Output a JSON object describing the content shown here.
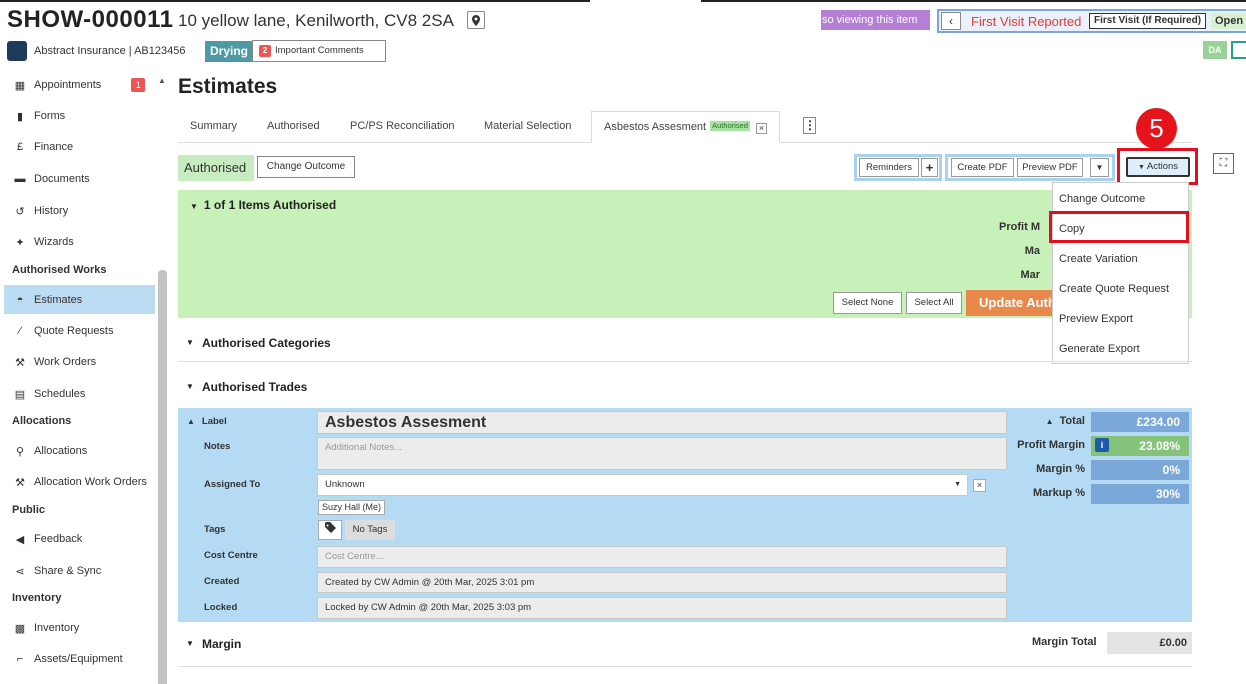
{
  "header": {
    "job_id": "SHOW-000011",
    "address": "10 yellow lane, Kenilworth, CV8 2SA",
    "viewing_notice": "so viewing this item",
    "status": "First Visit Reported",
    "first_visit_badge": "First Visit (If Required)",
    "open_badge": "Open",
    "insurer": "Abstract Insurance | AB123456",
    "drying_badge": "Drying",
    "important_count": "2",
    "important_label": "Important Comments",
    "user_initials": "DA"
  },
  "sidebar": {
    "items": [
      {
        "label": "Appointments",
        "icon": "calendar-icon",
        "badge": "1"
      },
      {
        "label": "Forms",
        "icon": "file-icon"
      },
      {
        "label": "Finance",
        "icon": "pound-icon"
      },
      {
        "label": "Documents",
        "icon": "folder-icon"
      },
      {
        "label": "History",
        "icon": "history-icon"
      },
      {
        "label": "Wizards",
        "icon": "magic-wand-icon"
      }
    ],
    "section_authorised": "Authorised Works",
    "authorised_items": [
      {
        "label": "Estimates",
        "icon": "hard-hat-icon",
        "active": true
      },
      {
        "label": "Quote Requests",
        "icon": "brush-icon"
      },
      {
        "label": "Work Orders",
        "icon": "hammer-icon"
      },
      {
        "label": "Schedules",
        "icon": "schedule-icon"
      }
    ],
    "section_allocations": "Allocations",
    "allocations_items": [
      {
        "label": "Allocations",
        "icon": "wrench-icon"
      },
      {
        "label": "Allocation Work Orders",
        "icon": "hammer-icon"
      }
    ],
    "section_public": "Public",
    "public_items": [
      {
        "label": "Feedback",
        "icon": "megaphone-icon"
      },
      {
        "label": "Share & Sync",
        "icon": "share-icon"
      }
    ],
    "section_inventory": "Inventory",
    "inventory_items": [
      {
        "label": "Inventory",
        "icon": "boxes-icon"
      },
      {
        "label": "Assets/Equipment",
        "icon": "dolly-icon"
      }
    ]
  },
  "main": {
    "title": "Estimates",
    "tabs": [
      "Summary",
      "Authorised",
      "PC/PS Reconciliation",
      "Material Selection"
    ],
    "active_tab": "Asbestos Assesment",
    "active_tab_badge": "Authorised",
    "outcome": "Authorised",
    "change_outcome": "Change Outcome",
    "reminders": "Reminders",
    "plus": "+",
    "create_pdf": "Create PDF",
    "preview_pdf": "Preview PDF",
    "actions": "Actions",
    "step_number": "5"
  },
  "actions_menu": {
    "items": [
      "Change Outcome",
      "Copy",
      "Create Variation",
      "Create Quote Request",
      "Preview Export",
      "Generate Export"
    ],
    "highlighted": "Copy"
  },
  "authorised_panel": {
    "title": "1 of 1 Items Authorised",
    "labels": [
      "Profit M",
      "Ma",
      "Mar"
    ],
    "select_none": "Select None",
    "select_all": "Select All",
    "update_button": "Update Auth"
  },
  "sections": {
    "categories": "Authorised Categories",
    "trades": "Authorised Trades",
    "margin": "Margin"
  },
  "trade_detail": {
    "label_label": "Label",
    "label_value": "Asbestos Assesment",
    "notes_label": "Notes",
    "notes_placeholder": "Additional Notes...",
    "assigned_label": "Assigned To",
    "assigned_value": "Unknown",
    "assigned_suggestion": "Suzy Hall (Me)",
    "tags_label": "Tags",
    "tags_value": "No Tags",
    "cost_centre_label": "Cost Centre",
    "cost_centre_placeholder": "Cost Centre...",
    "created_label": "Created",
    "created_value": "Created by CW Admin @ 20th Mar, 2025 3:01 pm",
    "locked_label": "Locked",
    "locked_value": "Locked by CW Admin @ 20th Mar, 2025 3:03 pm",
    "total_label": "Total",
    "total_value": "£234.00",
    "profit_margin_label": "Profit Margin",
    "profit_margin_value": "23.08%",
    "margin_pct_label": "Margin %",
    "margin_pct_value": "0%",
    "markup_label": "Markup %",
    "markup_value": "30%"
  },
  "margin": {
    "total_label": "Margin Total",
    "total_value": "£0.00"
  }
}
